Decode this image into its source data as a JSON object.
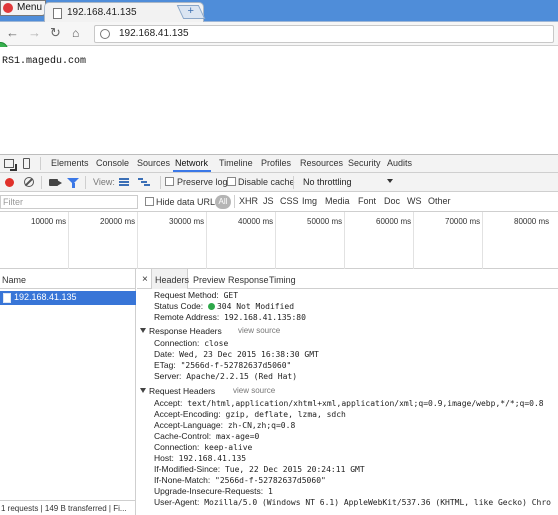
{
  "browser": {
    "menu_label": "Menu",
    "tab_title": "192.168.41.135",
    "new_tab_symbol": "+",
    "url": "192.168.41.135"
  },
  "page": {
    "body_text": "RS1.magedu.com"
  },
  "devtools": {
    "panel_tabs": [
      "Elements",
      "Console",
      "Sources",
      "Network",
      "Timeline",
      "Profiles",
      "Resources",
      "Security",
      "Audits"
    ],
    "active_panel": "Network",
    "toolbar": {
      "view_label": "View:",
      "preserve_log": "Preserve log",
      "disable_cache": "Disable cache",
      "throttling": "No throttling"
    },
    "filter": {
      "placeholder": "Filter",
      "hide_data_urls": "Hide data URLs",
      "all": "All",
      "types": [
        "XHR",
        "JS",
        "CSS",
        "Img",
        "Media",
        "Font",
        "Doc",
        "WS",
        "Other"
      ]
    },
    "timeline_ticks": [
      "10000 ms",
      "20000 ms",
      "30000 ms",
      "40000 ms",
      "50000 ms",
      "60000 ms",
      "70000 ms",
      "80000 ms"
    ],
    "requests": {
      "header": "Name",
      "items": [
        "192.168.41.135"
      ],
      "summary": "1 requests | 149 B transferred | Fi..."
    },
    "detail": {
      "close_symbol": "×",
      "tabs": [
        "Headers",
        "Preview",
        "Response",
        "Timing"
      ],
      "active_tab": "Headers",
      "general": [
        {
          "key": "Request Method:",
          "value": "GET"
        },
        {
          "key": "Status Code:",
          "value": "304 Not Modified"
        },
        {
          "key": "Remote Address:",
          "value": "192.168.41.135:80"
        }
      ],
      "response_headers_title": "Response Headers",
      "view_source": "view source",
      "response_headers": [
        {
          "key": "Connection:",
          "value": "close"
        },
        {
          "key": "Date:",
          "value": "Wed, 23 Dec 2015 16:38:30 GMT"
        },
        {
          "key": "ETag:",
          "value": "\"2566d-f-52782637d5060\""
        },
        {
          "key": "Server:",
          "value": "Apache/2.2.15 (Red Hat)"
        }
      ],
      "request_headers_title": "Request Headers",
      "request_headers": [
        {
          "key": "Accept:",
          "value": "text/html,application/xhtml+xml,application/xml;q=0.9,image/webp,*/*;q=0.8"
        },
        {
          "key": "Accept-Encoding:",
          "value": "gzip, deflate, lzma, sdch"
        },
        {
          "key": "Accept-Language:",
          "value": "zh-CN,zh;q=0.8"
        },
        {
          "key": "Cache-Control:",
          "value": "max-age=0"
        },
        {
          "key": "Connection:",
          "value": "keep-alive"
        },
        {
          "key": "Host:",
          "value": "192.168.41.135"
        },
        {
          "key": "If-Modified-Since:",
          "value": "Tue, 22 Dec 2015 20:24:11 GMT"
        },
        {
          "key": "If-None-Match:",
          "value": "\"2566d-f-52782637d5060\""
        },
        {
          "key": "Upgrade-Insecure-Requests:",
          "value": "1"
        },
        {
          "key": "User-Agent:",
          "value": "Mozilla/5.0 (Windows NT 6.1) AppleWebKit/537.36 (KHTML, like Gecko) Chro"
        }
      ]
    }
  },
  "colors": {
    "tabbar_blue": "#4f8dd9",
    "selection_blue": "#3875d7",
    "record_red": "#e0312b",
    "status_green": "#2ea84a"
  }
}
